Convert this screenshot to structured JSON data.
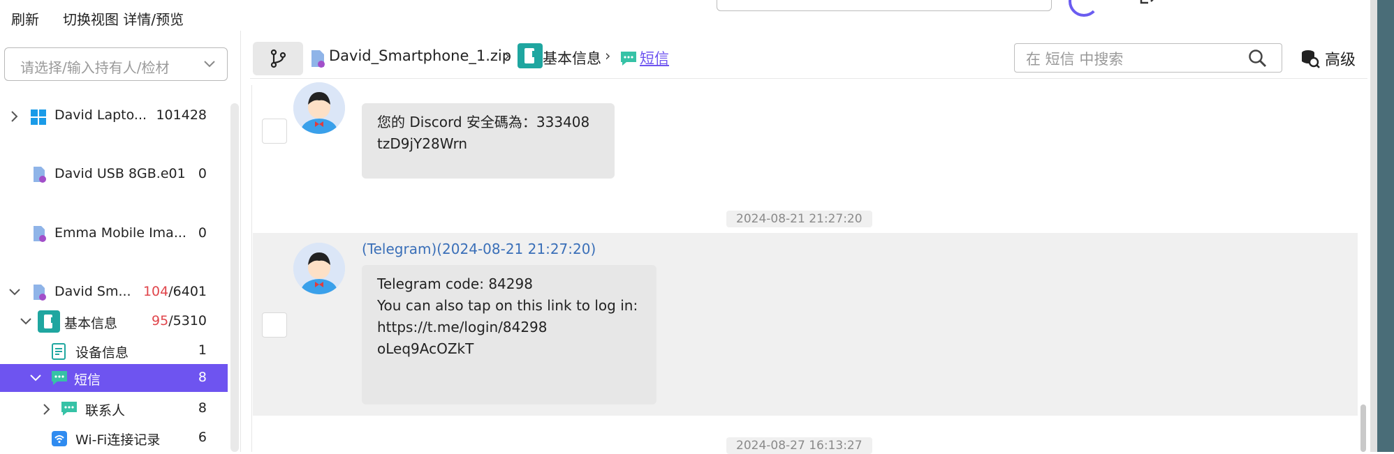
{
  "toolbar": {
    "refresh_label": "刷新",
    "switch_view_label": "切换视图 详情/预览"
  },
  "sidebar": {
    "holder_placeholder": "请选择/输入持有人/检材",
    "items": [
      {
        "label": "David Lapto...",
        "count": "101428"
      },
      {
        "label": "David USB 8GB.e01",
        "count": "0"
      },
      {
        "label": "Emma Mobile Ima...",
        "count": "0"
      },
      {
        "label": "David Sm...",
        "count_red": "104",
        "count_rest": "/6401"
      },
      {
        "label": "基本信息",
        "count_red": "95",
        "count_rest": "/5310"
      },
      {
        "label": "设备信息",
        "count": "1"
      },
      {
        "label": "短信",
        "count": "8"
      },
      {
        "label": "联系人",
        "count": "8"
      },
      {
        "label": "Wi-Fi连接记录",
        "count": "6"
      }
    ]
  },
  "breadcrumb": {
    "file": "David_Smartphone_1.zip",
    "basic": "基本信息",
    "sms": "短信"
  },
  "search": {
    "placeholder": "在 短信 中搜索",
    "advanced_label": "高级"
  },
  "messages": [
    {
      "lines": [
        "您的 Discord 安全碼為：333408",
        "",
        "tzD9jY28Wrn"
      ]
    },
    {
      "timestamp": "2024-08-21 21:27:20",
      "sender": "(Telegram)(2024-08-21 21:27:20)",
      "lines": [
        "Telegram code: 84298",
        "",
        "You can also tap on this link to log in:",
        "https://t.me/login/84298",
        "",
        "oLeq9AcOZkT"
      ]
    },
    {
      "timestamp": "2024-08-27 16:13:27"
    }
  ],
  "colors": {
    "accent": "#6e54f0",
    "link": "#3a6fb8",
    "alert": "#e0454b"
  }
}
